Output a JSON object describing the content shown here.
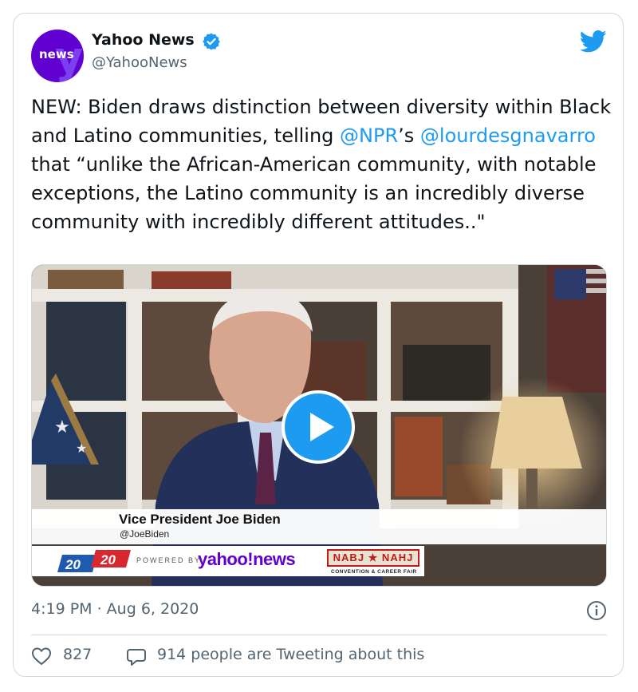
{
  "tweet": {
    "author": {
      "name": "Yahoo News",
      "handle": "@YahooNews",
      "avatar_text": "news"
    },
    "text_segments": [
      {
        "text": "NEW: Biden draws distinction between diversity within Black and Latino communities, telling ",
        "mention": false
      },
      {
        "text": "@NPR",
        "mention": true
      },
      {
        "text": "’s ",
        "mention": false
      },
      {
        "text": "@lourdesgnavarro",
        "mention": true
      },
      {
        "text": " that “unlike the African-American community, with notable exceptions, the Latino community is an incredibly diverse community with incredibly different attitudes..\"",
        "mention": false
      }
    ],
    "timestamp": "4:19 PM · Aug 6, 2020",
    "likes": "827",
    "reply_text": "914 people are Tweeting about this"
  },
  "video": {
    "caption_name": "Vice President Joe Biden",
    "caption_handle": "@JoeBiden",
    "logo_2020": [
      "20",
      "20"
    ],
    "powered_by": "POWERED BY",
    "yahoo_news_logo": "yahoo!news",
    "nabj_logo": "NABJ ★ NAHJ",
    "convention": "CONVENTION & CAREER FAIR"
  },
  "colors": {
    "accent": "#1d9bf0",
    "text": "#0f1419",
    "muted": "#536471",
    "border": "#cfd9de",
    "yahoo_purple": "#6001d2"
  },
  "icons": [
    "verified-badge-icon",
    "twitter-bird-icon",
    "play-icon",
    "info-icon",
    "heart-icon",
    "speech-bubble-icon"
  ]
}
